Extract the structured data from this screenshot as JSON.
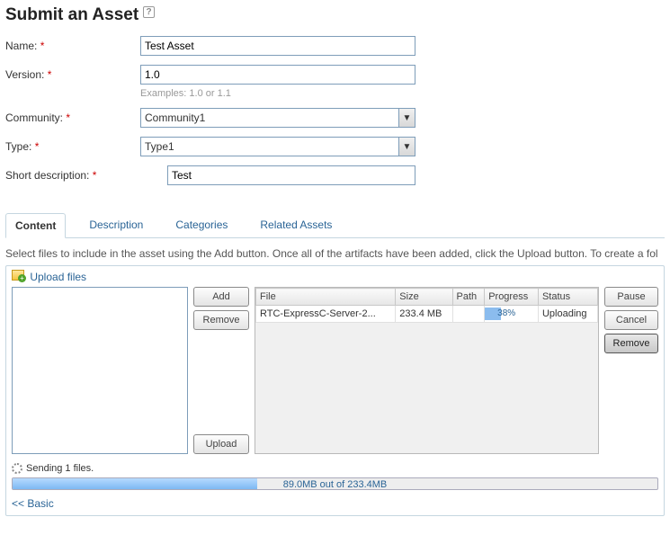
{
  "page_title": "Submit an Asset",
  "help_glyph": "?",
  "form": {
    "name": {
      "label": "Name:",
      "value": "Test Asset"
    },
    "version": {
      "label": "Version:",
      "value": "1.0",
      "hint": "Examples: 1.0 or 1.1"
    },
    "community": {
      "label": "Community:",
      "value": "Community1"
    },
    "type": {
      "label": "Type:",
      "value": "Type1"
    },
    "short_desc": {
      "label": "Short description:",
      "value": "Test"
    }
  },
  "tabs": {
    "content": "Content",
    "description": "Description",
    "categories": "Categories",
    "related": "Related Assets"
  },
  "instructions": "Select files to include in the asset using the Add button. Once all of the artifacts have been added, click the Upload button. To create a fol",
  "upload": {
    "title": "Upload files",
    "buttons": {
      "add": "Add",
      "remove": "Remove",
      "upload": "Upload",
      "pause": "Pause",
      "cancel": "Cancel"
    },
    "table": {
      "headers": {
        "file": "File",
        "size": "Size",
        "path": "Path",
        "progress": "Progress",
        "status": "Status"
      },
      "rows": [
        {
          "file": "RTC-ExpressC-Server-2...",
          "size": "233.4 MB",
          "path": "",
          "progress_pct": 38,
          "progress_label": "38%",
          "status": "Uploading"
        }
      ]
    },
    "sending": "Sending 1 files.",
    "big_progress": {
      "pct": 38,
      "label": "89.0MB out of 233.4MB"
    }
  },
  "basic_link": "<< Basic"
}
